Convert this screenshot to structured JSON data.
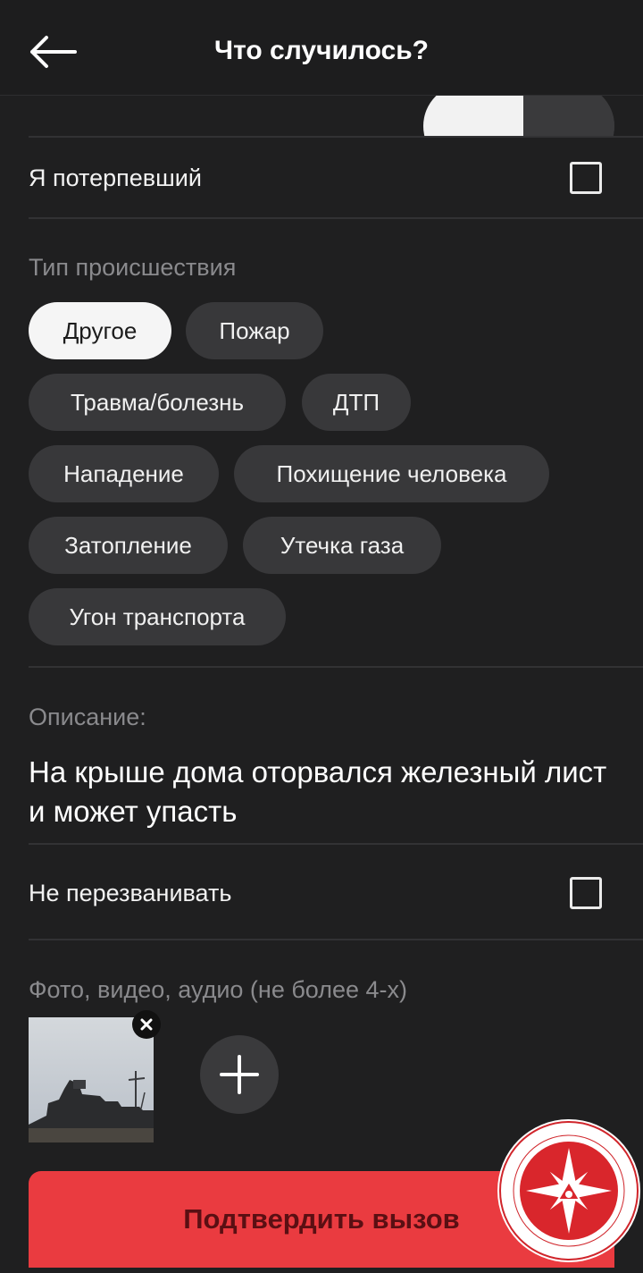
{
  "header": {
    "title": "Что случилось?",
    "back_icon": "arrow-left-icon"
  },
  "victim_row": {
    "label": "Я потерпевший",
    "checked": false
  },
  "incident_type": {
    "label": "Тип происшествия",
    "selected": "Другое",
    "options": [
      "Другое",
      "Пожар",
      "Травма/болезнь",
      "ДТП",
      "Нападение",
      "Похищение человека",
      "Затопление",
      "Утечка газа",
      "Угон транспорта"
    ]
  },
  "description": {
    "label": "Описание:",
    "value": "На крыше дома оторвался железный лист и может упасть"
  },
  "no_callback_row": {
    "label": "Не перезванивать",
    "checked": false
  },
  "media": {
    "label": "Фото, видео, аудио (не более 4-х)",
    "remove_icon": "close-icon",
    "add_icon": "plus-icon"
  },
  "confirm_button": {
    "label": "Подтвердить вызов"
  },
  "colors": {
    "background": "#1f1f20",
    "chip": "#38383a",
    "chip_selected": "#f5f5f5",
    "accent": "#ea3b40"
  }
}
